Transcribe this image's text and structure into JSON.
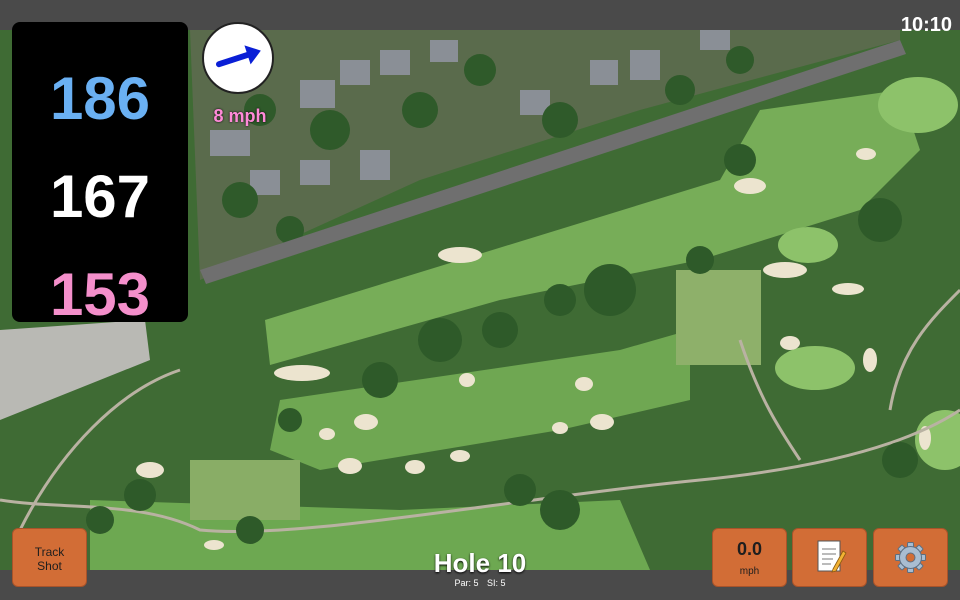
{
  "status_bar": {
    "time": "10:10"
  },
  "distances": {
    "back": "186",
    "middle": "167",
    "front": "153"
  },
  "wind": {
    "speed": "8 mph",
    "direction_icon": "arrow-right-icon"
  },
  "hole": {
    "title": "Hole 10",
    "par": "Par: 5",
    "si": "SI: 5"
  },
  "buttons": {
    "track_shot_line1": "Track",
    "track_shot_line2": "Shot",
    "speed_value": "0.0",
    "speed_unit": "mph",
    "notes_icon": "notepad-icon",
    "settings_icon": "gear-icon"
  },
  "colors": {
    "back_distance": "#6ab0f3",
    "middle_distance": "#ffffff",
    "front_distance": "#f48fcb",
    "wind_text": "#ff8ad8",
    "button": "#d26d36"
  }
}
